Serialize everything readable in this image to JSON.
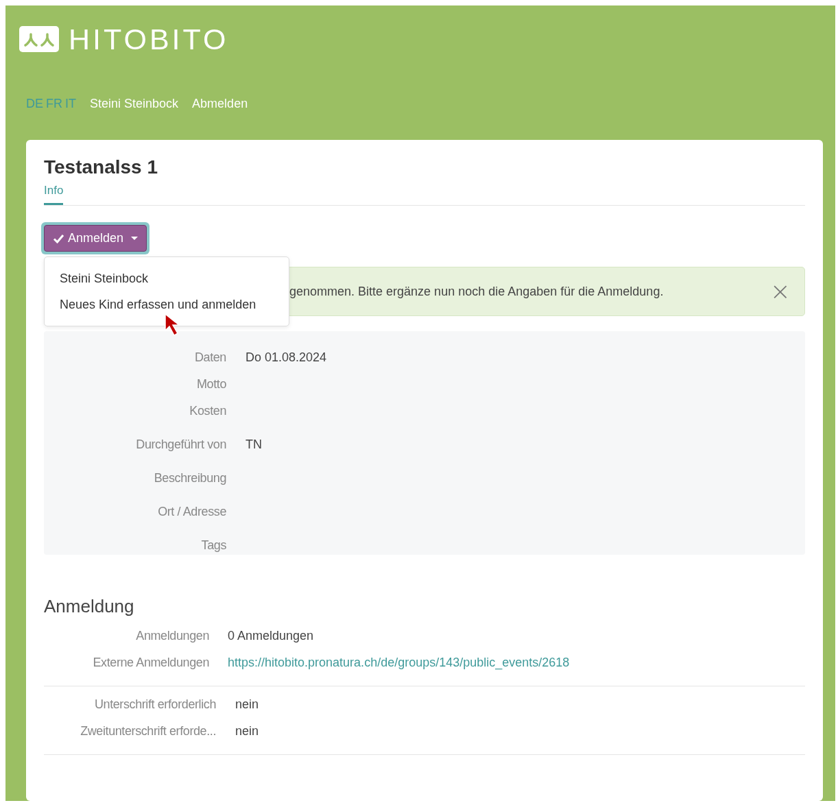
{
  "header": {
    "logo_text": "HITOBITO",
    "languages": [
      {
        "label": "DE",
        "selected": false
      },
      {
        "label": "FR",
        "selected": false
      },
      {
        "label": "IT",
        "selected": false
      }
    ],
    "user": "Steini Steinbock",
    "logout": "Abmelden"
  },
  "page": {
    "title": "Testanalss 1",
    "tabs": [
      {
        "label": "Info",
        "selected": true
      }
    ]
  },
  "register_button": {
    "label": "Anmelden",
    "expanded": true,
    "menu": [
      "Steini Steinbock",
      "Neues Kind erfassen und anmelden"
    ]
  },
  "alert": {
    "text": "genommen. Bitte ergänze nun noch die Angaben für die Anmeldung.",
    "close": "×"
  },
  "details": [
    [
      {
        "label": "Daten",
        "value": "Do 01.08.2024"
      },
      {
        "label": "Motto"
      },
      {
        "label": "Kosten"
      }
    ],
    [
      {
        "label": "Durchgeführt von",
        "value": "TN"
      }
    ],
    [
      {
        "label": "Beschreibung"
      }
    ],
    [
      {
        "label": "Ort / Adresse"
      }
    ],
    [
      {
        "label": "Tags"
      }
    ]
  ],
  "registration": {
    "title": "Anmeldung",
    "rows": [
      {
        "label": "Anmeldungen",
        "value": "0 Anmeldungen",
        "kind": "text"
      },
      {
        "label": "Externe Anmeldungen",
        "value": "https://hitobito.pronatura.ch/de/groups/143/public_events/2618",
        "kind": "link"
      }
    ],
    "signature_rows": [
      {
        "label": "Unterschrift erforderlich",
        "value": "nein"
      },
      {
        "label": "Zweitunterschrift erforde...",
        "value": "nein"
      }
    ]
  }
}
